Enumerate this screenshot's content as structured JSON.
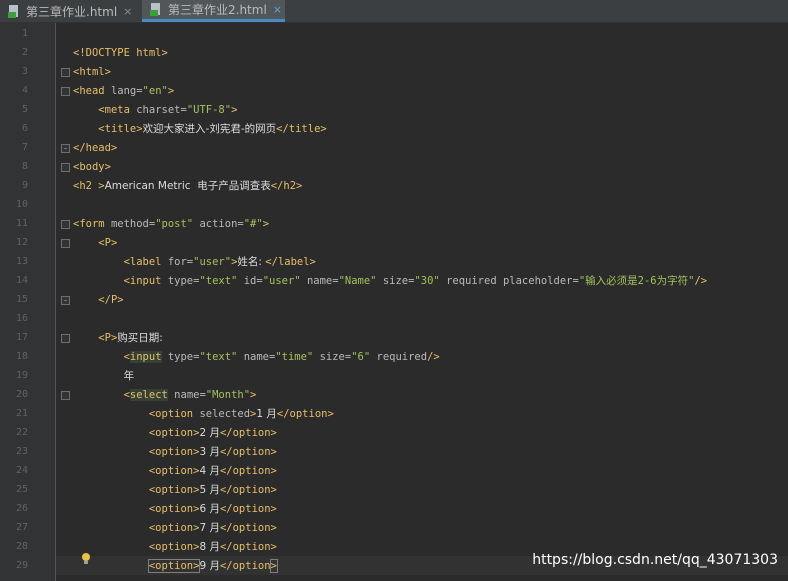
{
  "tabs": [
    {
      "label": "第三章作业.html",
      "close": "×",
      "active": false
    },
    {
      "label": "第三章作业2.html",
      "close": "×",
      "active": true
    }
  ],
  "lines": [
    {
      "no": "1",
      "html": ""
    },
    {
      "no": "2",
      "html": "<span class=\"tg\">&lt;!DOCTYPE html&gt;</span>"
    },
    {
      "no": "3",
      "html": "<span class=\"tg\">&lt;html&gt;</span>"
    },
    {
      "no": "4",
      "html": "<span class=\"tg\">&lt;head</span> <span class=\"an\">lang=</span><span class=\"av\">\"en\"</span><span class=\"tg\">&gt;</span>"
    },
    {
      "no": "5",
      "html": "    <span class=\"tg\">&lt;meta</span> <span class=\"an\">charset=</span><span class=\"av\">\"UTF-8\"</span><span class=\"tg\">&gt;</span>"
    },
    {
      "no": "6",
      "html": "    <span class=\"tg\">&lt;title&gt;</span><span class=\"tx\">欢迎大家进入-刘宪君-的网页</span><span class=\"tg\">&lt;/title&gt;</span>"
    },
    {
      "no": "7",
      "html": "<span class=\"tg\">&lt;/head&gt;</span>"
    },
    {
      "no": "8",
      "html": "<span class=\"tg\">&lt;body&gt;</span>"
    },
    {
      "no": "9",
      "html": "<span class=\"tg\">&lt;h2 &gt;</span><span class=\"tx\">American Metric  电子产品调查表</span><span class=\"tg\">&lt;/h2&gt;</span>"
    },
    {
      "no": "10",
      "html": ""
    },
    {
      "no": "11",
      "html": "<span class=\"tg\">&lt;form</span> <span class=\"an\">method=</span><span class=\"av\">\"post\"</span> <span class=\"an\">action=</span><span class=\"av\">\"#\"</span><span class=\"tg\">&gt;</span>"
    },
    {
      "no": "12",
      "html": "    <span class=\"tg\">&lt;P&gt;</span>"
    },
    {
      "no": "13",
      "html": "        <span class=\"tg\">&lt;label</span> <span class=\"an\">for=</span><span class=\"av\">\"user\"</span><span class=\"tg\">&gt;</span><span class=\"tx\">姓名: </span><span class=\"tg\">&lt;/label&gt;</span>"
    },
    {
      "no": "14",
      "html": "        <span class=\"tg\">&lt;input</span> <span class=\"an\">type=</span><span class=\"av\">\"text\"</span> <span class=\"an\">id=</span><span class=\"av\">\"user\"</span> <span class=\"an\">name=</span><span class=\"av\">\"Name\"</span> <span class=\"an\">size=</span><span class=\"av\">\"30\"</span> <span class=\"an\">required placeholder=</span><span class=\"av\">\"输入必须是2-6为字符\"</span><span class=\"tg\">/&gt;</span>"
    },
    {
      "no": "15",
      "html": "    <span class=\"tg\">&lt;/P&gt;</span>"
    },
    {
      "no": "16",
      "html": ""
    },
    {
      "no": "17",
      "html": "    <span class=\"tg\">&lt;P&gt;</span><span class=\"tx\">购买日期:</span>"
    },
    {
      "no": "18",
      "html": "        <span class=\"tg\">&lt;</span><span class=\"tg hl\">input</span> <span class=\"an\">type=</span><span class=\"av\">\"text\"</span> <span class=\"an\">name=</span><span class=\"av\">\"time\"</span> <span class=\"an\">size=</span><span class=\"av\">\"6\"</span> <span class=\"an\">required</span><span class=\"tg\">/&gt;</span>"
    },
    {
      "no": "19",
      "html": "        <span class=\"tx\">年</span>"
    },
    {
      "no": "20",
      "html": "        <span class=\"tg\">&lt;</span><span class=\"tg hl\">select</span> <span class=\"an\">name=</span><span class=\"av\">\"Month\"</span><span class=\"tg\">&gt;</span>"
    },
    {
      "no": "21",
      "html": "            <span class=\"tg\">&lt;option</span> <span class=\"an\">selected</span><span class=\"tg\">&gt;</span><span class=\"tx\">1 月</span><span class=\"tg\">&lt;/option&gt;</span>"
    },
    {
      "no": "22",
      "html": "            <span class=\"tg\">&lt;option&gt;</span><span class=\"tx\">2 月</span><span class=\"tg\">&lt;/option&gt;</span>"
    },
    {
      "no": "23",
      "html": "            <span class=\"tg\">&lt;option&gt;</span><span class=\"tx\">3 月</span><span class=\"tg\">&lt;/option&gt;</span>"
    },
    {
      "no": "24",
      "html": "            <span class=\"tg\">&lt;option&gt;</span><span class=\"tx\">4 月</span><span class=\"tg\">&lt;/option&gt;</span>"
    },
    {
      "no": "25",
      "html": "            <span class=\"tg\">&lt;option&gt;</span><span class=\"tx\">5 月</span><span class=\"tg\">&lt;/option&gt;</span>"
    },
    {
      "no": "26",
      "html": "            <span class=\"tg\">&lt;option&gt;</span><span class=\"tx\">6 月</span><span class=\"tg\">&lt;/option&gt;</span>"
    },
    {
      "no": "27",
      "html": "            <span class=\"tg\">&lt;option&gt;</span><span class=\"tx\">7 月</span><span class=\"tg\">&lt;/option&gt;</span>"
    },
    {
      "no": "28",
      "html": "            <span class=\"tg\">&lt;option&gt;</span><span class=\"tx\">8 月</span><span class=\"tg\">&lt;/option&gt;</span>"
    },
    {
      "no": "29",
      "html": "            <span class=\"tg brace\">&lt;option&gt;</span><span class=\"tx\">9 月</span><span class=\"tg\">&lt;/option</span><span class=\"tg brace\">&gt;</span><span class=\"caret\"></span>"
    }
  ],
  "watermark": "https://blog.csdn.net/qq_43071303"
}
